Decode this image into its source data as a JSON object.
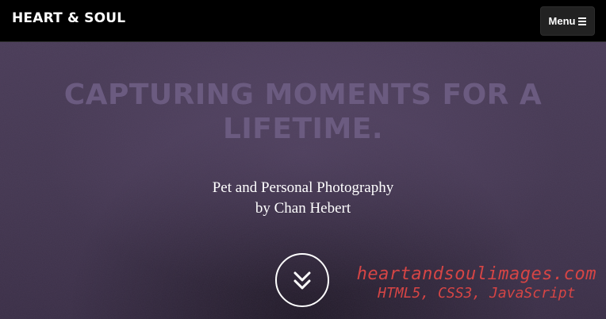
{
  "navbar": {
    "brand": "HEART & SOUL",
    "menu_label": "Menu"
  },
  "hero": {
    "headline": "CAPTURING MOMENTS FOR A LIFETIME.",
    "subtitle_line1": "Pet and Personal Photography",
    "subtitle_line2": "by Chan Hebert",
    "scroll_icon": "double-chevron-down-icon"
  },
  "watermark": {
    "url": "heartandsoulimages.com",
    "tech": "HTML5, CSS3, JavaScript"
  },
  "colors": {
    "nav_bg": "#000000",
    "hero_bg": "#443851",
    "headline": "#6b5b80",
    "watermark": "#d64545"
  }
}
